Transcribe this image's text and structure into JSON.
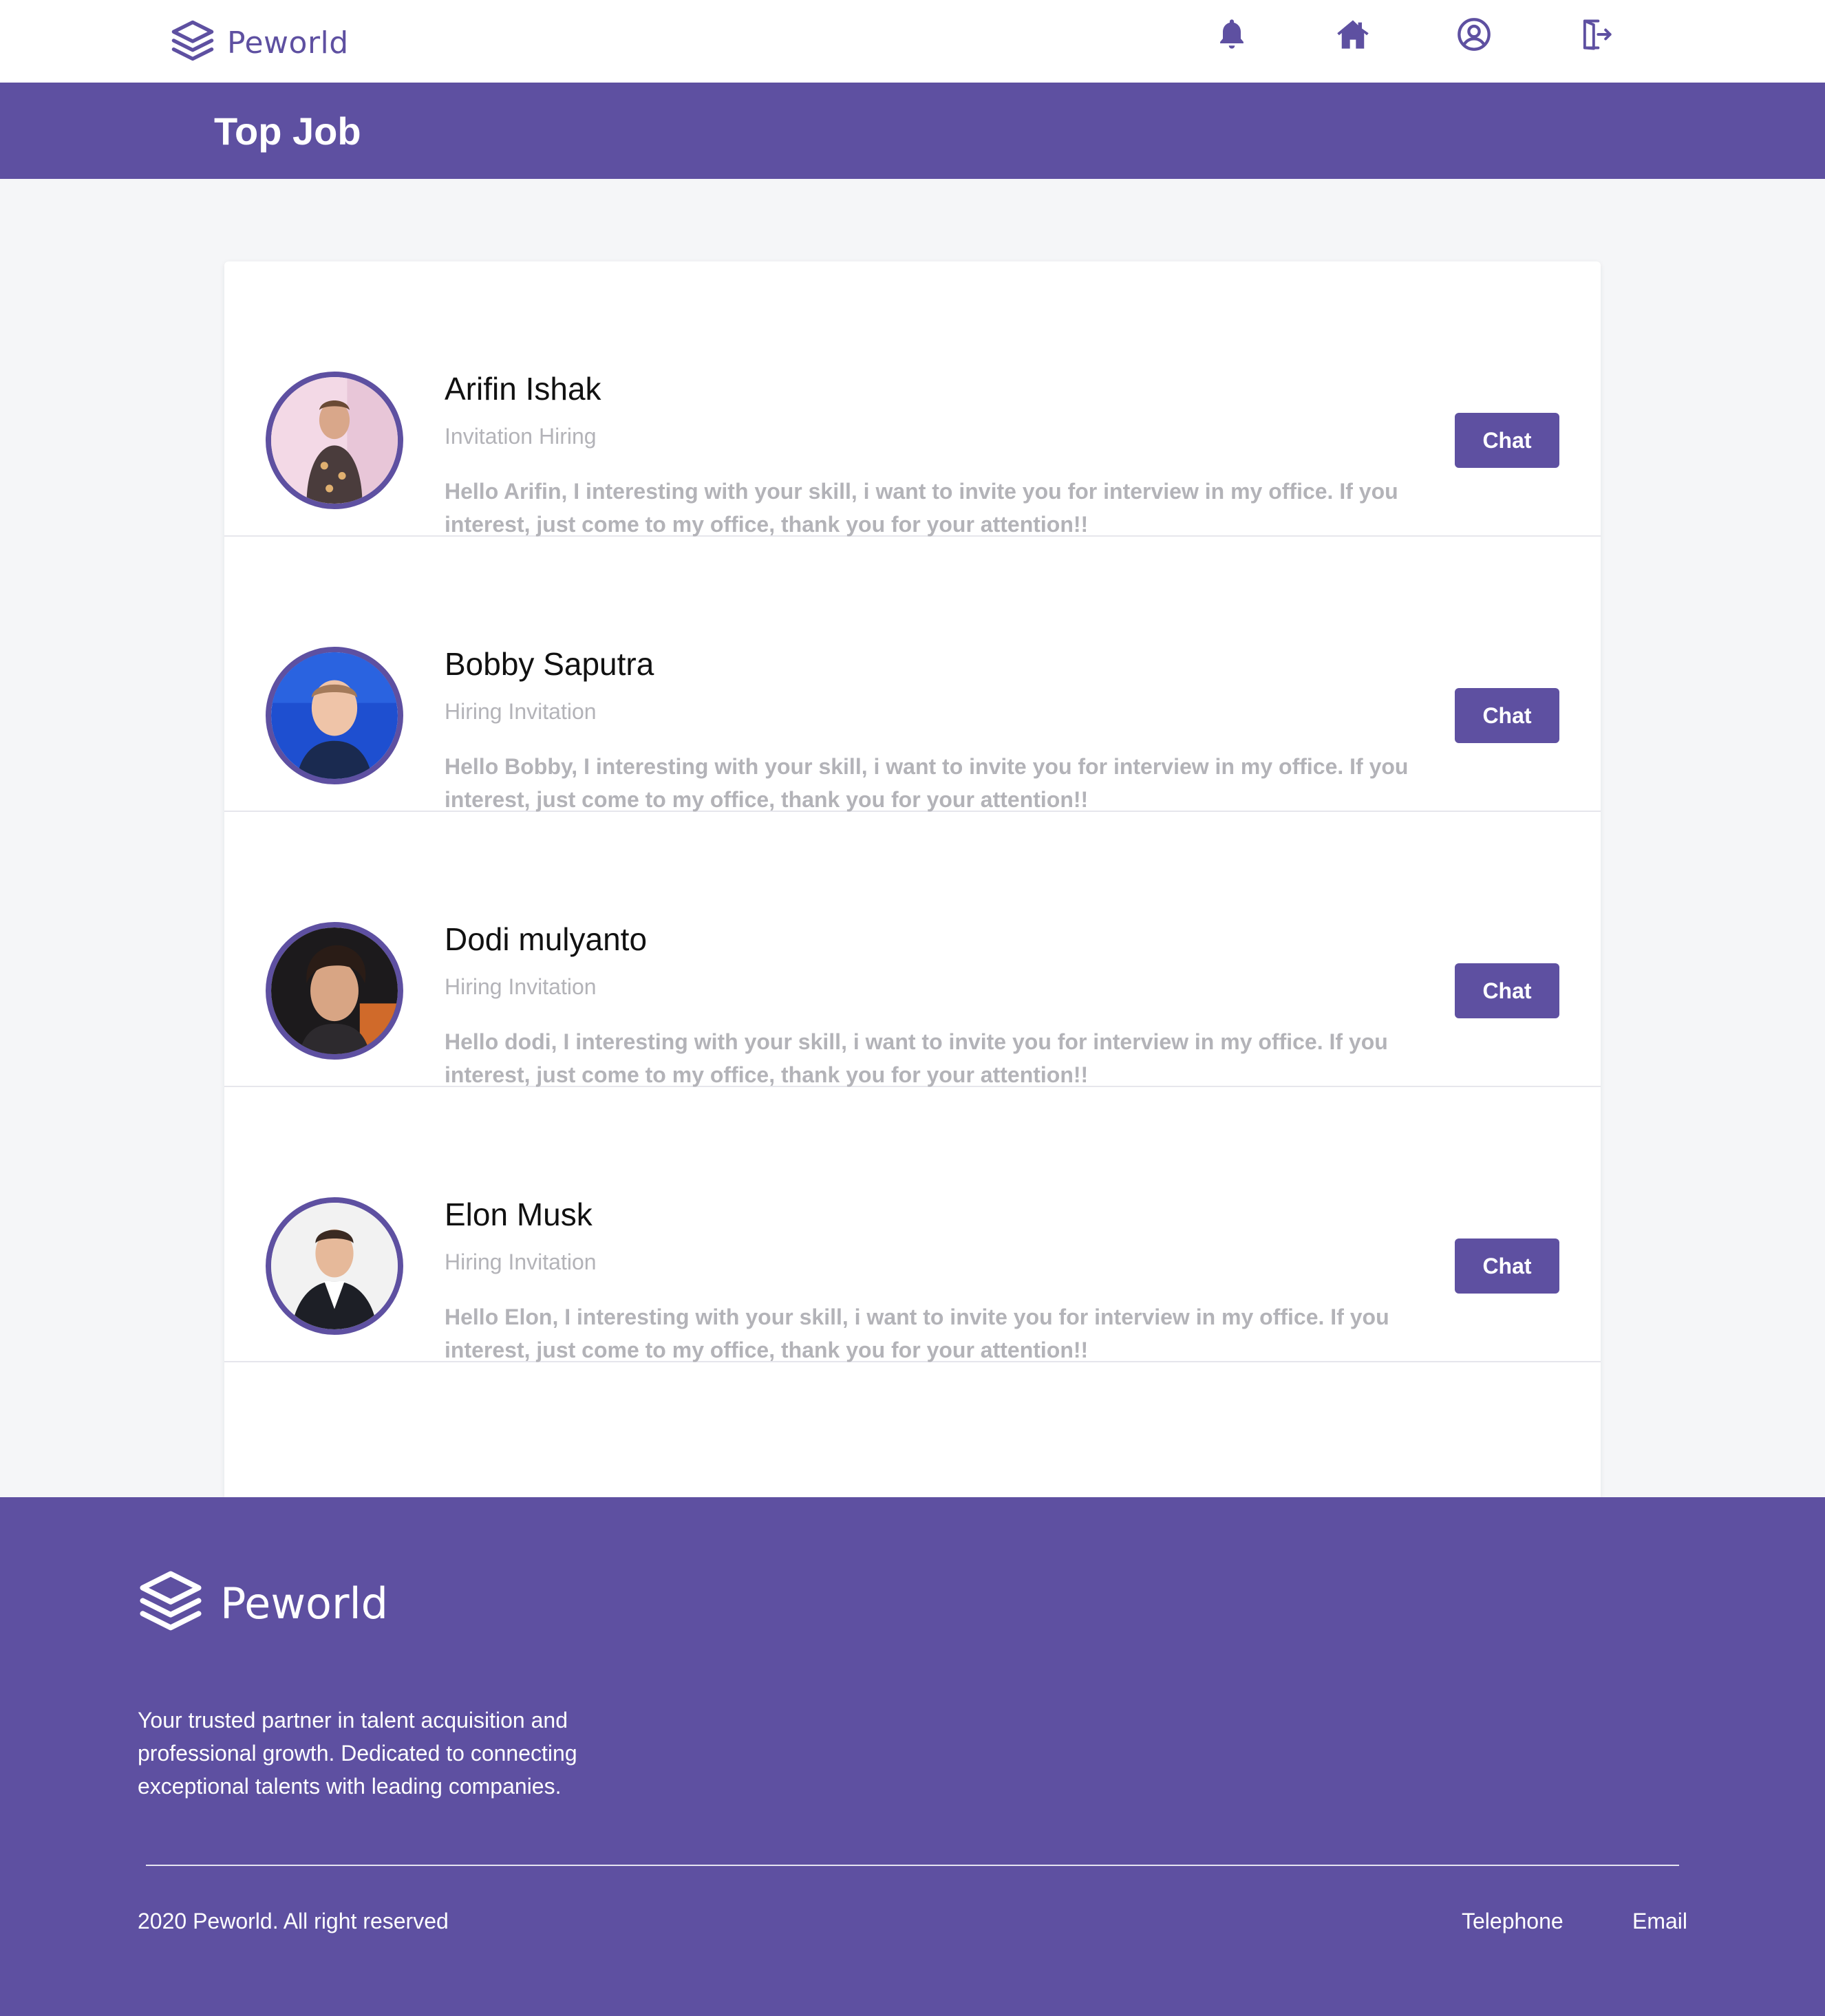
{
  "navbar": {
    "brand": "Peworld",
    "icons": [
      "bell-icon",
      "home-icon",
      "user-circle-icon",
      "logout-icon"
    ]
  },
  "header": {
    "title": "Top Job"
  },
  "invitations": [
    {
      "name": "Arifin Ishak",
      "subtitle": "Invitation Hiring",
      "message": "Hello Arifin, I interesting with your skill, i want to invite you for interview in my office. If you interest, just come to my office, thank you for your attention!!",
      "button": "Chat"
    },
    {
      "name": "Bobby Saputra",
      "subtitle": "Hiring Invitation",
      "message": "Hello Bobby, I interesting with your skill, i want to invite you for interview in my office. If you interest, just come to my office, thank you for your attention!!",
      "button": "Chat"
    },
    {
      "name": "Dodi mulyanto",
      "subtitle": "Hiring Invitation",
      "message": "Hello dodi, I interesting with your skill, i want to invite you for interview in my office. If you interest, just come to my office, thank you for your attention!!",
      "button": "Chat"
    },
    {
      "name": "Elon Musk",
      "subtitle": "Hiring Invitation",
      "message": "Hello Elon, I interesting with your skill, i want to invite you for interview in my office. If you interest, just come to my office, thank you for your attention!!",
      "button": "Chat"
    }
  ],
  "footer": {
    "brand": "Peworld",
    "description": "Your trusted partner in talent acquisition and professional growth. Dedicated to connecting exceptional talents with leading companies.",
    "copyright": "2020 Peworld. All right reserved",
    "links": [
      "Telephone",
      "Email"
    ]
  },
  "colors": {
    "primary": "#5e50a1",
    "background": "#f5f6f8",
    "muted_text": "#b3b3b8"
  }
}
